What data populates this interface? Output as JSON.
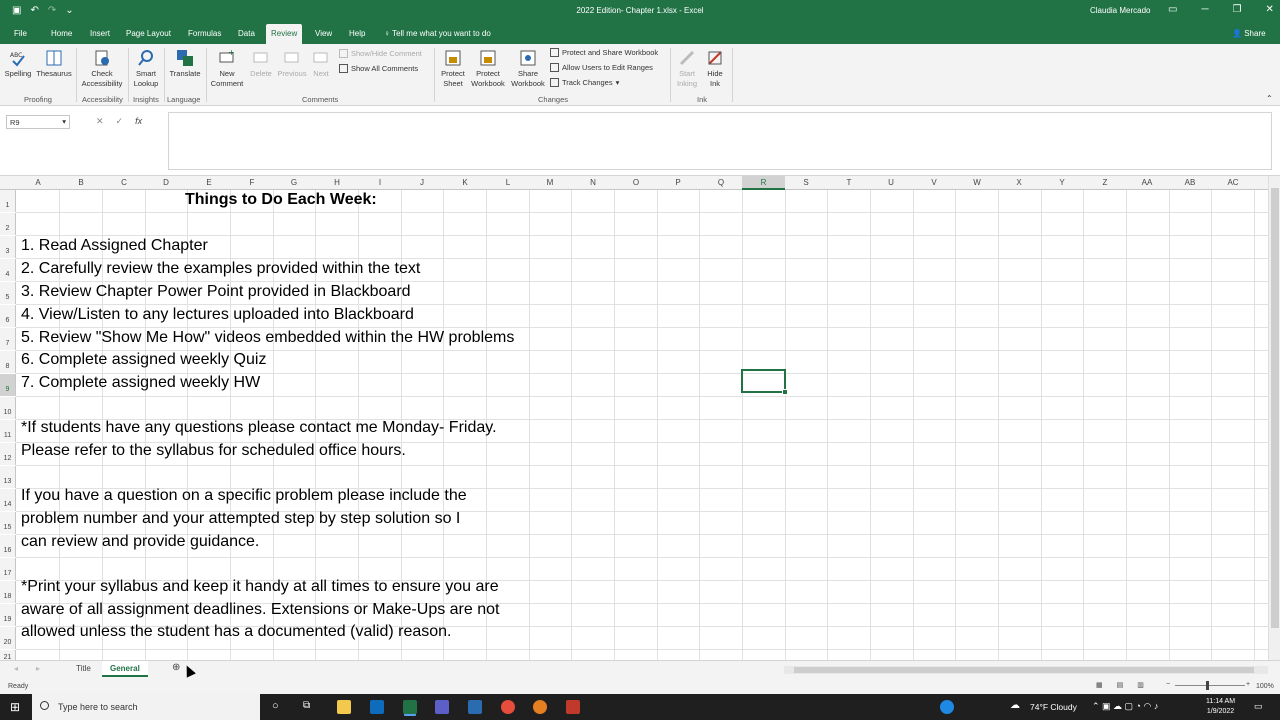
{
  "titlebar": {
    "doc_title": "2022 Edition- Chapter 1.xlsx  -  Excel",
    "user": "Claudia Mercado"
  },
  "ribbon_tabs": [
    "File",
    "Home",
    "Insert",
    "Page Layout",
    "Formulas",
    "Data",
    "Review",
    "View",
    "Help"
  ],
  "active_tab": "Review",
  "tell_me": "Tell me what you want to do",
  "share_label": "Share",
  "ribbon": {
    "spelling": "Spelling",
    "thesaurus": "Thesaurus",
    "check_accessibility": "Check Accessibility",
    "smart_lookup": "Smart Lookup",
    "translate": "Translate",
    "new_comment": "New Comment",
    "delete": "Delete",
    "previous": "Previous",
    "next": "Next",
    "show_hide_comment": "Show/Hide Comment",
    "show_all_comments": "Show All Comments",
    "protect_sheet": "Protect Sheet",
    "protect_workbook": "Protect Workbook",
    "share_workbook": "Share Workbook",
    "protect_share_workbook": "Protect and Share Workbook",
    "allow_edit_ranges": "Allow Users to Edit Ranges",
    "track_changes": "Track Changes",
    "start_inking": "Start Inking",
    "hide_ink": "Hide Ink",
    "groups": {
      "proofing": "Proofing",
      "accessibility": "Accessibility",
      "insights": "Insights",
      "language": "Language",
      "comments": "Comments",
      "changes": "Changes",
      "ink": "Ink"
    }
  },
  "formula_bar": {
    "name_box": "R9",
    "fx": "fx"
  },
  "columns": [
    "A",
    "B",
    "C",
    "D",
    "E",
    "F",
    "G",
    "H",
    "I",
    "J",
    "K",
    "L",
    "M",
    "N",
    "O",
    "P",
    "Q",
    "R",
    "S",
    "T",
    "U",
    "V",
    "W",
    "X",
    "Y",
    "Z",
    "AA",
    "AB",
    "AC"
  ],
  "selected_column": "R",
  "rows": [
    "1",
    "2",
    "3",
    "4",
    "5",
    "6",
    "7",
    "8",
    "9",
    "10",
    "11",
    "12",
    "13",
    "14",
    "15",
    "16",
    "17",
    "18",
    "19",
    "20",
    "21"
  ],
  "sheet": {
    "heading": "Things to Do Each Week:",
    "lines": [
      {
        "row": "3",
        "text": "1. Read Assigned Chapter"
      },
      {
        "row": "4",
        "text": "2. Carefully review the examples provided within the text"
      },
      {
        "row": "5",
        "text": "3. Review Chapter Power Point provided in Blackboard"
      },
      {
        "row": "6",
        "text": "4. View/Listen to any lectures uploaded into Blackboard"
      },
      {
        "row": "7",
        "text": "5. Review \"Show Me How\" videos embedded within the HW problems"
      },
      {
        "row": "8",
        "text": "6. Complete assigned weekly Quiz"
      },
      {
        "row": "9",
        "text": "7. Complete assigned weekly HW"
      },
      {
        "row": "11",
        "text": "*If students have any questions please contact me Monday- Friday."
      },
      {
        "row": "12",
        "text": "Please refer to the syllabus for scheduled office hours."
      },
      {
        "row": "14",
        "text": "If you have a question on a specific problem please include the"
      },
      {
        "row": "15",
        "text": "problem number and your attempted step by step solution so I"
      },
      {
        "row": "16",
        "text": "can review and provide guidance."
      },
      {
        "row": "18",
        "text": "*Print your syllabus and keep it handy at all times to ensure you are"
      },
      {
        "row": "19",
        "text": "aware of all assignment deadlines. Extensions or Make-Ups are not"
      },
      {
        "row": "20",
        "text": "allowed unless the student has a documented (valid) reason."
      }
    ]
  },
  "sheet_tabs": [
    "Title",
    "General"
  ],
  "active_sheet": "General",
  "status": {
    "ready": "Ready",
    "zoom": "100%"
  },
  "taskbar": {
    "search_placeholder": "Type here to search",
    "weather": "74°F  Cloudy",
    "time": "11:14 AM",
    "date": "1/9/2022"
  },
  "colors": {
    "excel_green": "#217346",
    "taskbar": "#1f1f1f"
  }
}
